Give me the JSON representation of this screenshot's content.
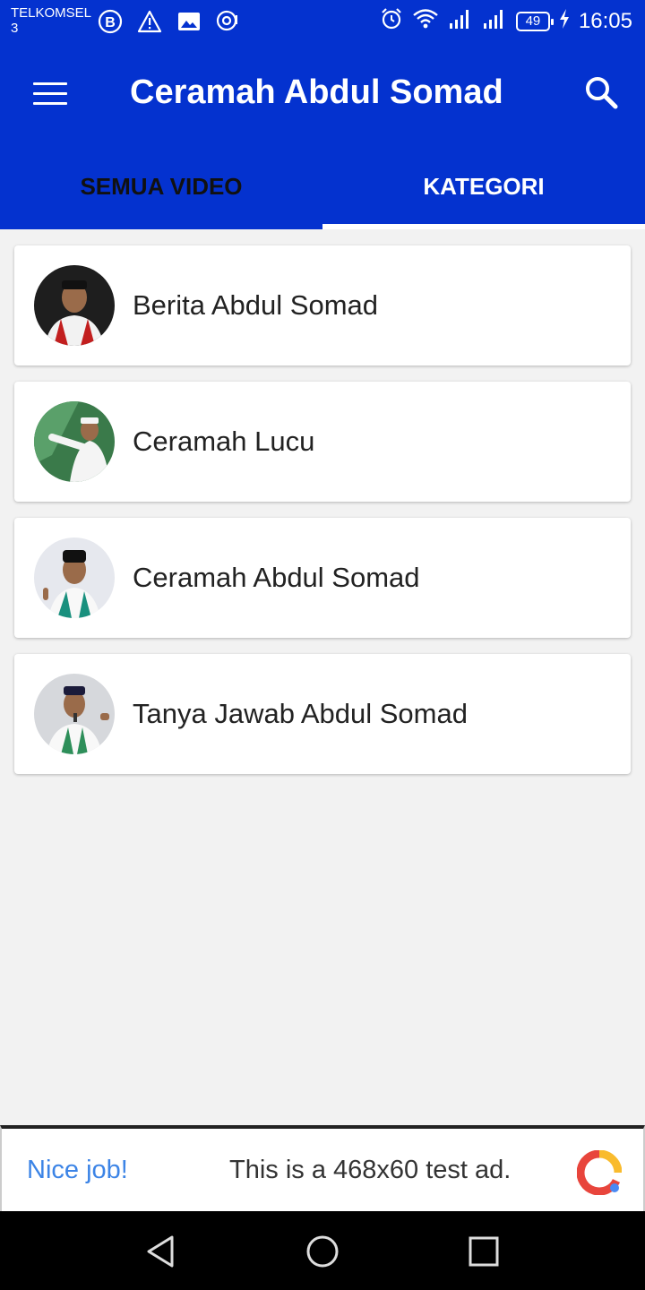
{
  "status_bar": {
    "carrier": "TELKOMSEL",
    "carrier_sub": "3",
    "battery": "49",
    "time": "16:05",
    "icons": [
      "b-icon",
      "warning-icon",
      "image-icon",
      "hotspot-icon",
      "alarm-icon",
      "wifi-icon",
      "signal-icon",
      "signal-icon-2",
      "charging-icon"
    ]
  },
  "app_bar": {
    "title": "Ceramah Abdul Somad",
    "menu_icon": "hamburger-menu-icon",
    "search_icon": "search-icon",
    "background": "#0432cf"
  },
  "tabs": [
    {
      "label": "SEMUA VIDEO",
      "active": false
    },
    {
      "label": "KATEGORI",
      "active": true
    }
  ],
  "categories": [
    {
      "label": "Berita Abdul Somad",
      "avatar": "avatar-photo"
    },
    {
      "label": "Ceramah Lucu",
      "avatar": "avatar-photo"
    },
    {
      "label": "Ceramah Abdul Somad",
      "avatar": "avatar-photo"
    },
    {
      "label": "Tanya Jawab Abdul Somad",
      "avatar": "avatar-photo"
    }
  ],
  "ad": {
    "headline": "Nice job!",
    "text": "This is a 468x60 test ad.",
    "accent": "#3c84e6"
  },
  "nav_bar": {
    "buttons": [
      "back-icon",
      "home-icon",
      "recents-icon"
    ]
  }
}
